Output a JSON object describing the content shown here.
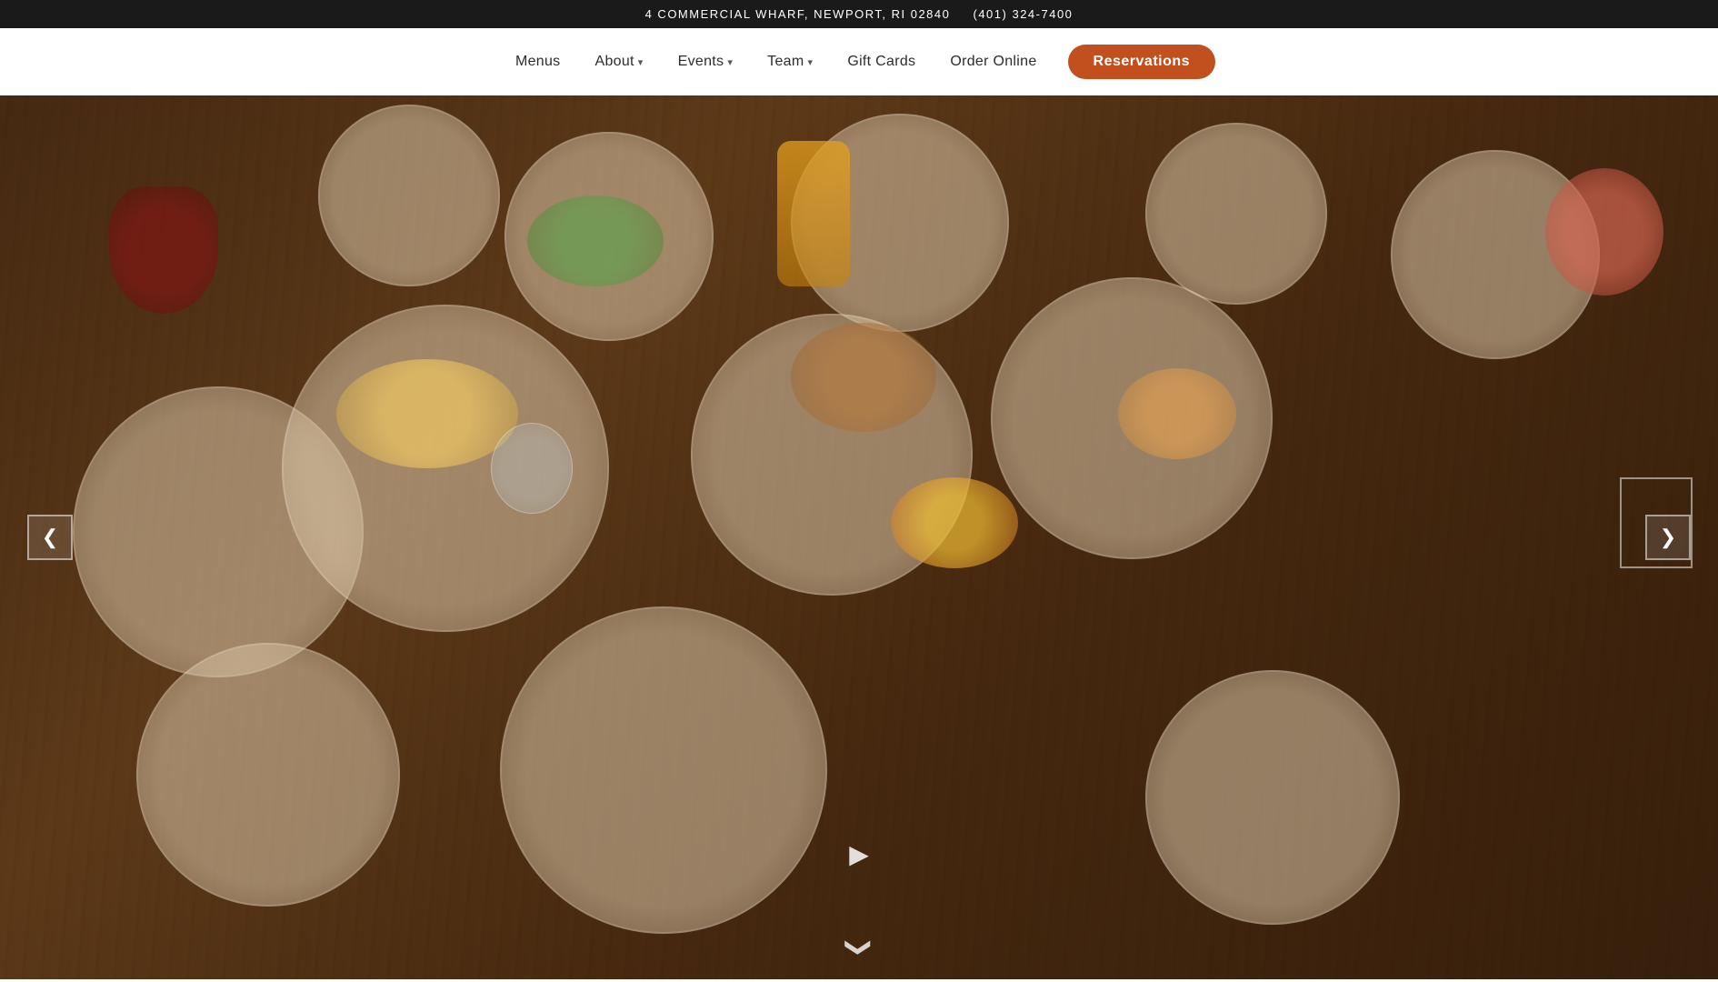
{
  "topbar": {
    "address": "4 COMMERCIAL WHARF, NEWPORT, RI 02840",
    "phone": "(401) 324-7400"
  },
  "nav": {
    "menus_label": "Menus",
    "about_label": "About",
    "events_label": "Events",
    "team_label": "Team",
    "gift_cards_label": "Gift Cards",
    "order_online_label": "Order Online",
    "reservations_label": "Reservations"
  },
  "hero": {
    "arrow_left": "❮",
    "arrow_right": "❯",
    "play_icon": "▶",
    "scroll_icon": "❯"
  }
}
